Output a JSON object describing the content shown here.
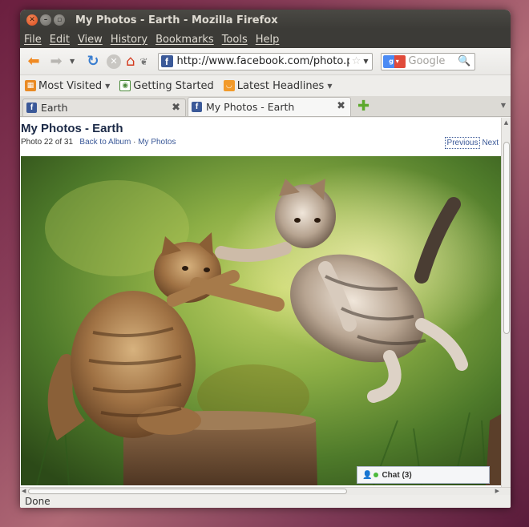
{
  "window": {
    "title": "My Photos - Earth - Mozilla Firefox"
  },
  "menu": [
    "File",
    "Edit",
    "View",
    "History",
    "Bookmarks",
    "Tools",
    "Help"
  ],
  "nav": {
    "url": "http://www.facebook.com/photo.php",
    "search_placeholder": "Google"
  },
  "bookmarks": [
    {
      "label": "Most Visited",
      "dropdown": true
    },
    {
      "label": "Getting Started",
      "dropdown": false
    },
    {
      "label": "Latest Headlines",
      "dropdown": true
    }
  ],
  "tabs": [
    {
      "label": "Earth",
      "active": false
    },
    {
      "label": "My Photos - Earth",
      "active": true
    }
  ],
  "page": {
    "title": "My Photos - Earth",
    "photo_counter": "Photo 22 of 31",
    "back_link": "Back to Album",
    "separator": " · ",
    "my_photos_link": "My Photos",
    "previous": "Previous",
    "next": "Next"
  },
  "chat": {
    "label": "Chat",
    "count": "(3)"
  },
  "status": "Done",
  "colors": {
    "facebook_blue": "#3b5998",
    "title_dark": "#1c2a47"
  }
}
